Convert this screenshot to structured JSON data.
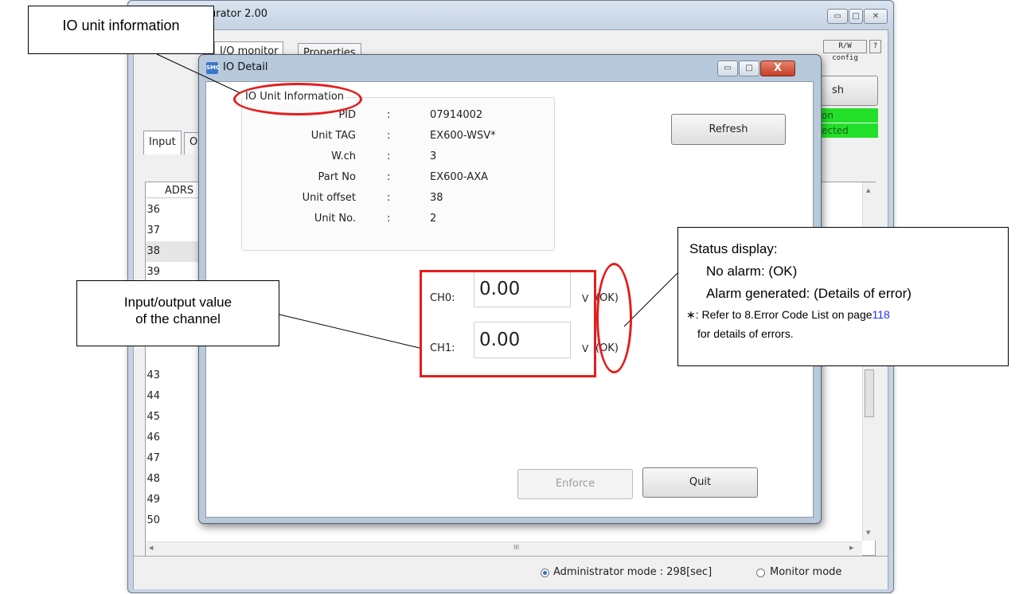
{
  "main_window": {
    "title": "urator 2.00",
    "tabs": [
      "I/O monitor",
      "Properties"
    ],
    "rw_config_label": "R/W config",
    "help_label": "?",
    "refresh_label": "sh",
    "status_badges": [
      "on",
      "ected"
    ],
    "sub_tabs": [
      "Input",
      "O"
    ],
    "list_header": "ADRS",
    "rows": [
      "36",
      "37",
      "38",
      "39",
      "43",
      "44",
      "45",
      "46",
      "47",
      "48",
      "49",
      "50"
    ],
    "hscroll_grip": "III",
    "status_bar": {
      "admin_mode": "Administrator mode : 298[sec]",
      "monitor_mode": "Monitor mode",
      "selected": "admin"
    }
  },
  "dialog": {
    "title": "IO Detail",
    "close_label": "X",
    "info_title": "IO Unit Information",
    "fields": [
      {
        "label": "PID",
        "value": "07914002"
      },
      {
        "label": "Unit TAG",
        "value": "EX600-WSV*"
      },
      {
        "label": "W.ch",
        "value": "3"
      },
      {
        "label": "Part No",
        "value": "EX600-AXA"
      },
      {
        "label": "Unit offset",
        "value": "38"
      },
      {
        "label": "Unit No.",
        "value": "2"
      }
    ],
    "colon": ":",
    "refresh_label": "Refresh",
    "channels": [
      {
        "label": "CH0:",
        "value": "0.00",
        "unit": "V",
        "status": "(OK)"
      },
      {
        "label": "CH1:",
        "value": "0.00",
        "unit": "V",
        "status": "(OK)"
      }
    ],
    "enforce_label": "Enforce",
    "quit_label": "Quit"
  },
  "annotations": {
    "io_unit_info": "IO unit information",
    "channel_value": [
      "Input/output value",
      "of the channel"
    ],
    "status_display": {
      "title": "Status display:",
      "no_alarm": "No alarm: (OK)",
      "alarm": "Alarm generated: (Details of error)",
      "note_prefix": "∗: Refer to 8.Error Code List on page",
      "note_page": "118",
      "note_suffix": "for details of errors."
    }
  },
  "colors": {
    "annotation_red": "#e41d1d",
    "status_green": "#22e02a",
    "link_blue": "#1a33ff"
  }
}
